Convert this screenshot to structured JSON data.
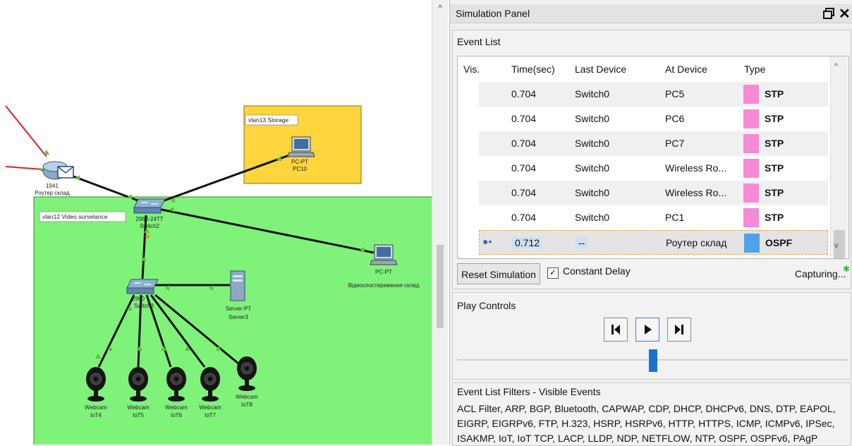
{
  "workspace": {
    "vlans": [
      {
        "label": "vlan13  Storage"
      },
      {
        "label": "vlan12  Video survelance"
      }
    ],
    "devices": {
      "router": {
        "model": "1941",
        "name": "Роутер склад"
      },
      "switch2": {
        "model": "2960-24TT",
        "name": "Switch2"
      },
      "switch3": {
        "model": "2960",
        "name": "Switch3"
      },
      "pc10": {
        "model": "PC-PT",
        "name": "PC10"
      },
      "pc_cam": {
        "model": "PC-PT",
        "name": "Відеоспостереження склад"
      },
      "server3": {
        "model": "Server-PT",
        "name": "Server3"
      },
      "webcams": [
        {
          "model": "Webcam",
          "name": "IoT4"
        },
        {
          "model": "Webcam",
          "name": "IoT5"
        },
        {
          "model": "Webcam",
          "name": "IoT6"
        },
        {
          "model": "Webcam",
          "name": "IoT7"
        },
        {
          "model": "Webcam",
          "name": "IoT8"
        }
      ]
    }
  },
  "panel": {
    "title": "Simulation Panel",
    "event_list": {
      "heading": "Event List",
      "columns": [
        "Vis.",
        "Time(sec)",
        "Last Device",
        "At Device",
        "Type"
      ],
      "rows": [
        {
          "time": "0.704",
          "last": "Switch0",
          "at": "PC5",
          "type": "STP",
          "color": "#f58ad7",
          "shaded": true
        },
        {
          "time": "0.704",
          "last": "Switch0",
          "at": "PC6",
          "type": "STP",
          "color": "#f58ad7",
          "shaded": false
        },
        {
          "time": "0.704",
          "last": "Switch0",
          "at": "PC7",
          "type": "STP",
          "color": "#f58ad7",
          "shaded": true
        },
        {
          "time": "0.704",
          "last": "Switch0",
          "at": "Wireless Ro...",
          "type": "STP",
          "color": "#f58ad7",
          "shaded": false
        },
        {
          "time": "0.704",
          "last": "Switch0",
          "at": "Wireless Ro...",
          "type": "STP",
          "color": "#f58ad7",
          "shaded": true
        },
        {
          "time": "0.704",
          "last": "Switch0",
          "at": "PC1",
          "type": "STP",
          "color": "#f58ad7",
          "shaded": false
        },
        {
          "time": "0.712",
          "last": "--",
          "at": "Роутер склад",
          "type": "OSPF",
          "color": "#4ea3ec",
          "shaded": false,
          "selected": true
        }
      ],
      "reset_label": "Reset Simulation",
      "constant_delay_label": "Constant Delay",
      "constant_delay_checked": "✓",
      "capturing_label": "Capturing..."
    },
    "play_controls": {
      "heading": "Play Controls",
      "slider_position": 0.5
    },
    "filters": {
      "heading": "Event List Filters - Visible Events",
      "list": "ACL Filter, ARP, BGP, Bluetooth, CAPWAP, CDP, DHCP, DHCPv6, DNS, DTP, EAPOL, EIGRP, EIGRPv6, FTP, H.323, HSRP, HSRPv6, HTTP, HTTPS, ICMP, ICMPv6, IPSec, ISAKMP, IoT, IoT TCP, LACP, LLDP, NDP, NETFLOW, NTP, OSPF, OSPFv6, PAgP"
    }
  }
}
